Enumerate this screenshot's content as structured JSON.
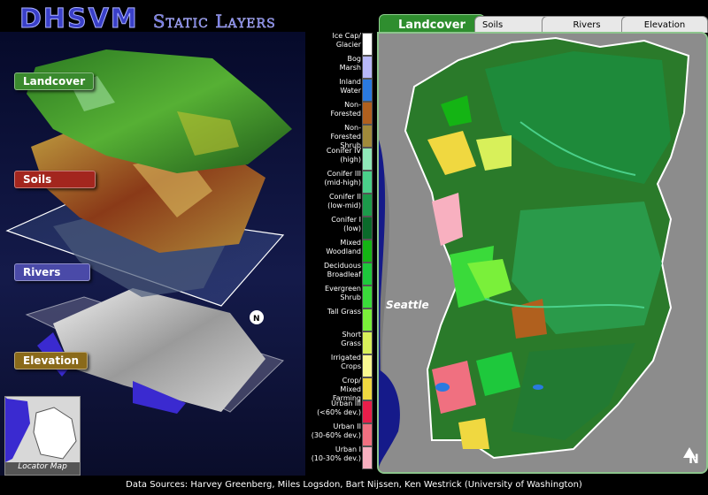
{
  "header": {
    "title_main": "DHSVM",
    "title_sub": "Static Layers"
  },
  "tabs": [
    {
      "label": "Landcover",
      "active": true
    },
    {
      "label": "Soils",
      "active": false
    },
    {
      "label": "Rivers",
      "active": false
    },
    {
      "label": "Elevation",
      "active": false
    }
  ],
  "layers": [
    {
      "label": "Landcover",
      "color": "#3a8a2e"
    },
    {
      "label": "Soils",
      "color": "#a3261e"
    },
    {
      "label": "Rivers",
      "color": "#4a4aa8"
    },
    {
      "label": "Elevation",
      "color": "#8a6a1a"
    }
  ],
  "legend": [
    {
      "label": "Ice Cap/\nGlacier",
      "color": "#ffffff"
    },
    {
      "label": "Bog\nMarsh",
      "color": "#b8b8f8"
    },
    {
      "label": "Inland\nWater",
      "color": "#2a7ae0"
    },
    {
      "label": "Non-\nForested",
      "color": "#b0601e"
    },
    {
      "label": "Non-\nForested\nShrub",
      "color": "#a08a3a"
    },
    {
      "label": "Conifer IV\n(high)",
      "color": "#90e8b8"
    },
    {
      "label": "Conifer III\n(mid-high)",
      "color": "#4ad08a"
    },
    {
      "label": "Conifer II\n(low-mid)",
      "color": "#1c9a4a"
    },
    {
      "label": "Conifer I\n(low)",
      "color": "#0a6a2a"
    },
    {
      "label": "Mixed\nWoodland",
      "color": "#14b414"
    },
    {
      "label": "Deciduous\nBroadleaf",
      "color": "#1ec83c"
    },
    {
      "label": "Evergreen\nShrub",
      "color": "#3ada3a"
    },
    {
      "label": "Tall Grass",
      "color": "#7af03a"
    },
    {
      "label": "Short\nGrass",
      "color": "#d8f05a"
    },
    {
      "label": "Irrigated\nCrops",
      "color": "#f8f890"
    },
    {
      "label": "Crop/\nMixed\nFarming",
      "color": "#f0d840"
    },
    {
      "label": "Urban III\n(<60% dev.)",
      "color": "#e81e4a"
    },
    {
      "label": "Urban II\n(30-60% dev.)",
      "color": "#f07080"
    },
    {
      "label": "Urban I\n(10-30% dev.)",
      "color": "#f8b0c0"
    }
  ],
  "map": {
    "city_label": "Seattle",
    "north_label": "N"
  },
  "locator": {
    "label": "Locator Map"
  },
  "footer": {
    "text": "Data Sources: Harvey Greenberg, Miles Logsdon, Bart Nijssen, Ken Westrick (University of Washington)"
  }
}
